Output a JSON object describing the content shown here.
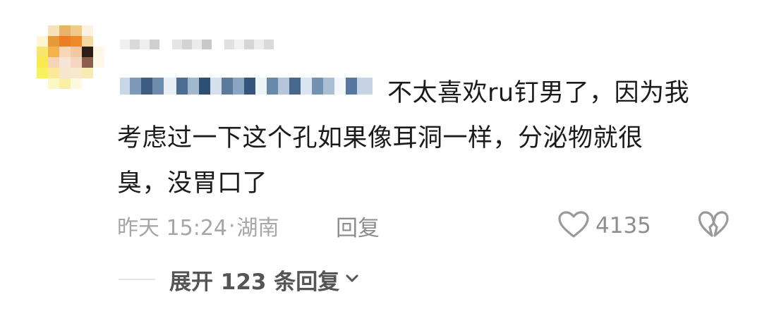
{
  "comment": {
    "avatar_icon": "blurred-avatar-icon",
    "username_obscured": true,
    "mention_obscured": true,
    "text_line1_tail": "不太喜欢ru钉男了，因为我",
    "text_line2": "考虑过一下这个孔如果像耳洞一样，分泌物就很",
    "text_line3": "臭，没胃口了",
    "timestamp": "昨天 15:24",
    "location_separator": "·",
    "location": "湖南",
    "reply_label": "回复",
    "like_icon": "heart-outline-icon",
    "like_count": "4135",
    "dislike_icon": "broken-heart-icon"
  },
  "replies": {
    "expand_label": "展开 123 条回复",
    "chevron_icon": "chevron-down-icon"
  },
  "colors": {
    "text_primary": "#1b1b1b",
    "text_meta": "#a6a6a6",
    "text_action": "#8e8e8e",
    "icon_stroke": "#9a9a9a",
    "expand_text": "#555555"
  }
}
